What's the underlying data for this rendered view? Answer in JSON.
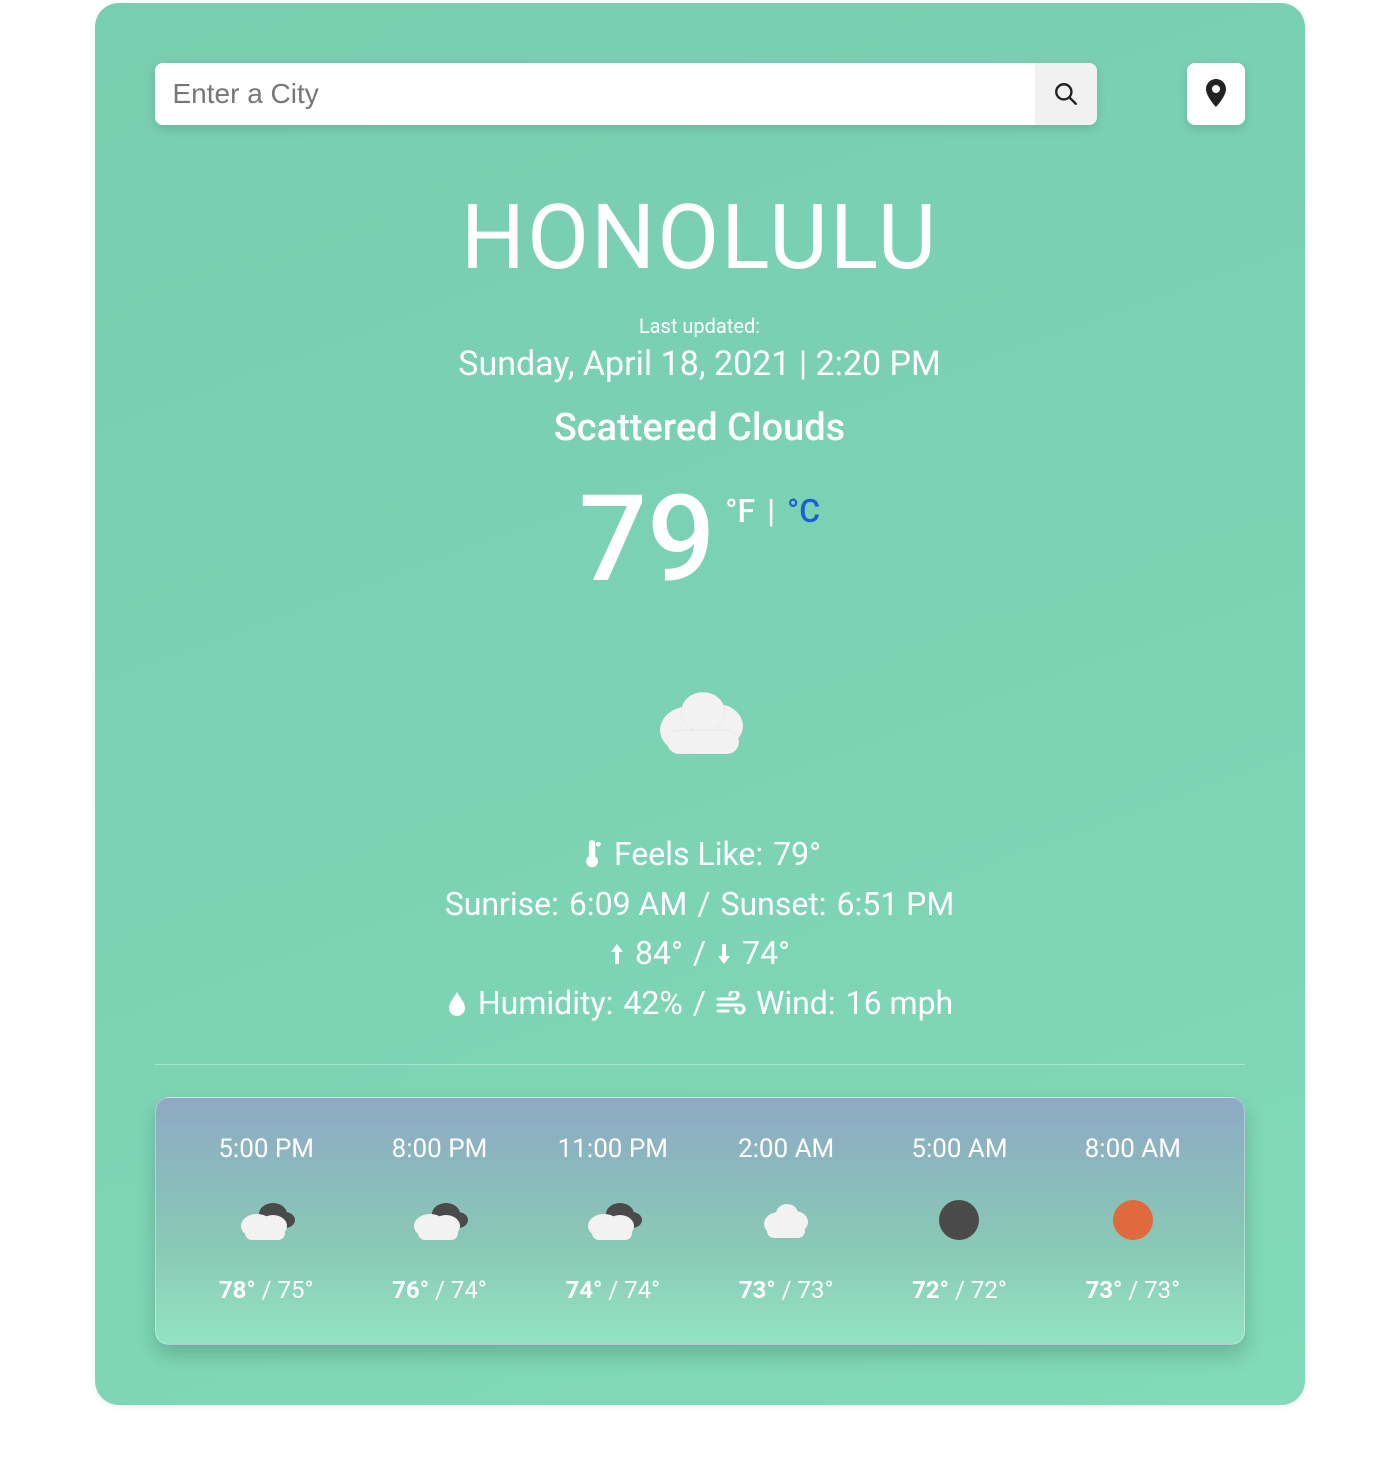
{
  "search": {
    "placeholder": "Enter a City",
    "value": ""
  },
  "city": "HONOLULU",
  "last_updated_label": "Last updated:",
  "last_updated_time": "Sunday, April 18, 2021 | 2:20 PM",
  "condition": "Scattered Clouds",
  "temperature": "79",
  "units": {
    "f": "°F",
    "sep": " | ",
    "c": "°C"
  },
  "details": {
    "feels_like_label": "Feels Like:",
    "feels_like_value": "79°",
    "sunrise_label": "Sunrise:",
    "sunrise_value": "6:09 AM",
    "sunset_sep": "/",
    "sunset_label": "Sunset:",
    "sunset_value": "6:51 PM",
    "high": "84°",
    "hl_sep": "/",
    "low": "74°",
    "humidity_label": "Humidity:",
    "humidity_value": "42%",
    "hw_sep": "/",
    "wind_label": "Wind:",
    "wind_value": "16 mph"
  },
  "forecast": [
    {
      "time": "5:00 PM",
      "icon": "cloud-dark",
      "hi": "78°",
      "lo": "75°"
    },
    {
      "time": "8:00 PM",
      "icon": "cloud-dark",
      "hi": "76°",
      "lo": "74°"
    },
    {
      "time": "11:00 PM",
      "icon": "cloud-dark",
      "hi": "74°",
      "lo": "74°"
    },
    {
      "time": "2:00 AM",
      "icon": "cloud",
      "hi": "73°",
      "lo": "73°"
    },
    {
      "time": "5:00 AM",
      "icon": "sun-dark",
      "hi": "72°",
      "lo": "72°"
    },
    {
      "time": "8:00 AM",
      "icon": "sun-orange",
      "hi": "73°",
      "lo": "73°"
    }
  ]
}
